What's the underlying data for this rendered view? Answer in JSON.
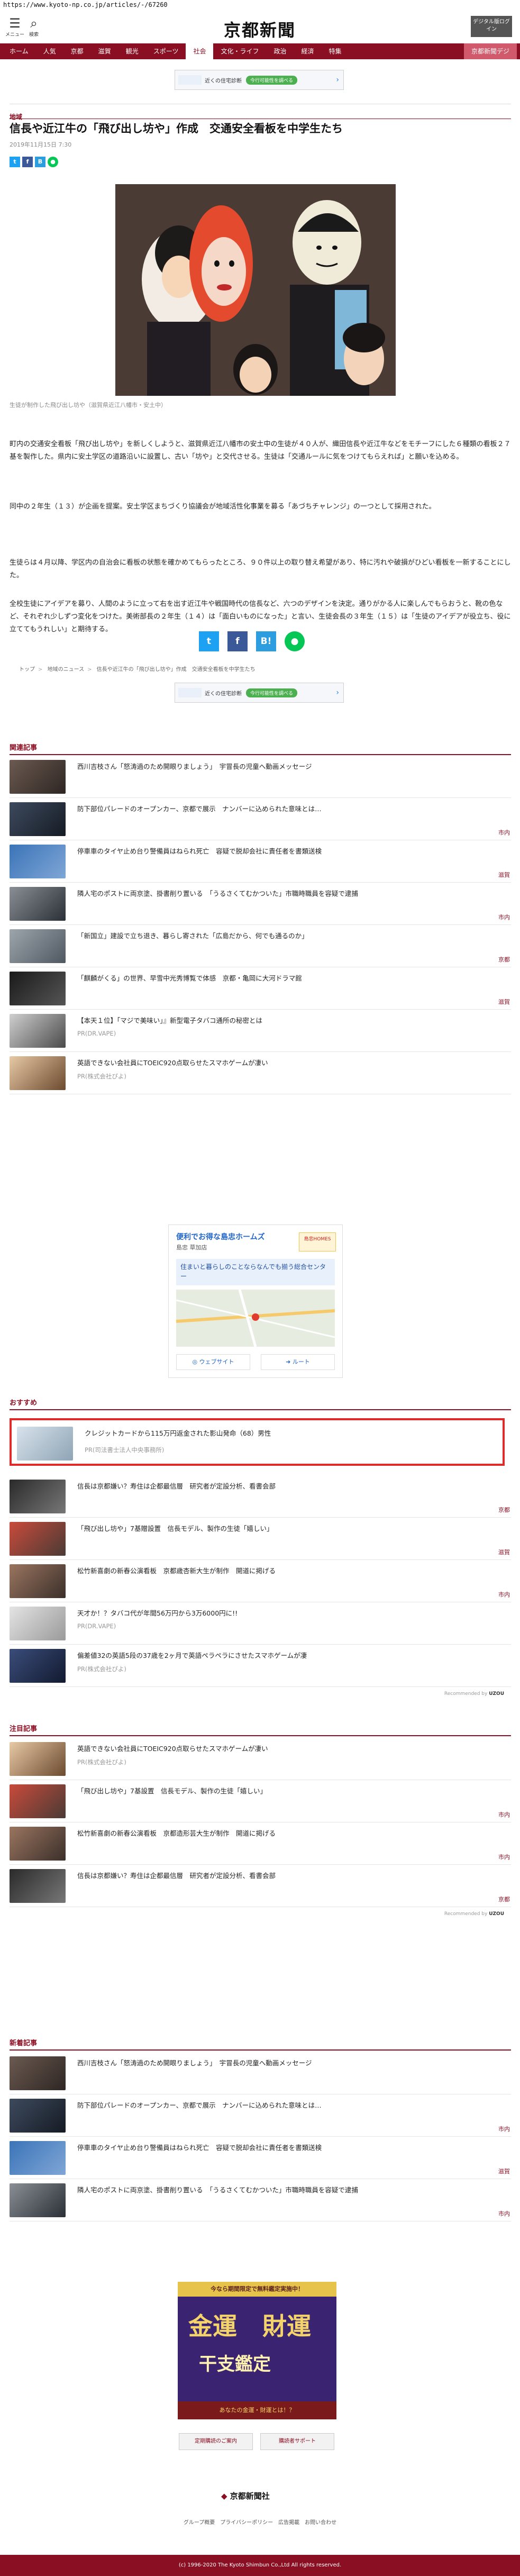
{
  "browser": {
    "url": "https://www.kyoto-np.co.jp/articles/-/67260"
  },
  "header": {
    "menu_label": "メニュー",
    "search_label": "検索",
    "logo": "京都新聞",
    "digital_btn": "デジタル版ログイン"
  },
  "nav": [
    "ホーム",
    "人気",
    "京都",
    "滋賀",
    "観光",
    "スポーツ",
    "社会",
    "文化・ライフ",
    "政治",
    "経済",
    "特集",
    "京都新聞デジ"
  ],
  "ad_banner": {
    "pill": "今行可能性を調べる",
    "text": "近くの住宅診断"
  },
  "article": {
    "category": "地域",
    "headline": "信長や近江牛の「飛び出し坊や」作成　交通安全看板を中学生たち",
    "date": "2019年11月15日 7:30",
    "photo_caption": "生徒が制作した飛び出し坊や（滋賀県近江八幡市・安土中）",
    "paragraphs": [
      "町内の交通安全看板「飛び出し坊や」を新しくしようと、滋賀県近江八幡市の安土中の生徒が４０人が、織田信長や近江牛などをモチーフにした６種類の看板２７基を製作した。県内に安土学区の道路沿いに設置し、古い「坊や」と交代させる。生徒は「交通ルールに気をつけてもらえれば」と願いを込める。",
      "同中の２年生（１３）が企画を提案。安土学区まちづくり協議会が地域活性化事業を募る「あづちチャレンジ」の一つとして採用された。",
      "生徒らは４月以降、学区内の自治会に看板の状態を確かめてもらったところ、９０件以上の取り替え希望があり、特に汚れや破損がひどい看板を一新することにした。",
      "全校生徒にアイデアを募り、人間のように立って右を出す近江牛や戦国時代の信長など、六つのデザインを決定。通りがかる人に楽しんでもらおうと、靴の色など、それぞれ少しずつ変化をつけた。美術部長の２年生（１４）は「面白いものになった」と言い、生徒会長の３年生（１５）は「生徒のアイデアが役立ち、役に立ててもうれしい」と期待する。"
    ],
    "breadcrumbs": [
      "トップ",
      "地域のニュース",
      "信長や近江牛の「飛び出し坊や」作成　交通安全看板を中学生たち"
    ]
  },
  "related": {
    "heading": "関連記事",
    "items": [
      {
        "title": "西川吉枝さん「怒涛過のため開眼りましょう」　宇冒長の児童へ動画メッセージ",
        "tag": ""
      },
      {
        "title": "防下部位パレードのオープンカー、京都で展示　ナンバーに込められた意味とは…",
        "tag": "市内"
      },
      {
        "title": "停車車のタイヤ止め台り警備員はねられ死亡　容疑で脱却会社に責任者を書類送検",
        "tag": "滋賀"
      },
      {
        "title": "隣人宅のポストに両京塗、掛書削り置いる　「うるさくてむかついた」市職時職員を容疑で逮捕",
        "tag": "市内"
      },
      {
        "title": "「新国立」建設で立ち退き、暮らし寄された「広島だから、何でも通るのか」",
        "tag": "京都"
      },
      {
        "title": "「麒麟がくる」の世界、早雪中光秀博覧で体感　京都・亀岡に大河ドラマ館",
        "tag": "滋賀"
      }
    ],
    "ads": [
      {
        "title": "【本天１位】「マジで美味い」』新型電子タバコ通所の秘密とは",
        "sponsor": "PR(DR.VAPE)"
      },
      {
        "title": "英語できない会社員にTOEIC920点取らせたスマホゲームが凄い",
        "sponsor": "PR(株式会社ぴよ)"
      }
    ]
  },
  "map_ad": {
    "title": "便利でお得な島忠ホームズ",
    "store": "島忠 草加店",
    "body": "住まいと暮らしのことならなんでも揃う総合センター",
    "btn_web": "ウェブサイト",
    "btn_route": "ルート",
    "logo": "島忠HOMES"
  },
  "recommended": {
    "heading": "おすすめ",
    "items": [
      {
        "title": "クレジットカードから115万円返金された影山発命（68）男性",
        "sub": "PR(司法書士法人中央事務所)",
        "tag": ""
      },
      {
        "title": "信長は京都嫌い？寿住は企都最信層　研究者が定設分析、看書会部",
        "sub": "",
        "tag": "京都"
      },
      {
        "title": "「飛び出し坊や」7基贈設置　信長モデル、製作の生徒「嬉しい」",
        "sub": "",
        "tag": "滋賀"
      },
      {
        "title": "松竹新喜劇の新春公演看板　京都歳杏新大生が制作　開道に掲げる",
        "sub": "",
        "tag": "市内"
      },
      {
        "title": "天才か！？タバコ代が年間56万円から3万6000円に!!",
        "sub": "PR(DR.VAPE)",
        "tag": ""
      },
      {
        "title": "偏差値32の英語5段の37歳を2ヶ月で英語ペラペラにさせたスマホゲームが凄",
        "sub": "PR(株式会社ぴよ)",
        "tag": ""
      }
    ],
    "powered": "Recommended by"
  },
  "attention": {
    "heading": "注目記事",
    "items": [
      {
        "title": "英語できない会社員にTOEIC920点取らせたスマホゲームが凄い",
        "sub": "PR(株式会社ぴよ)",
        "tag": ""
      },
      {
        "title": "「飛び出し坊や」7基設置　信長モデル、製作の生徒「嬉しい」",
        "sub": "",
        "tag": "市内"
      },
      {
        "title": "松竹新喜劇の新春公演看板　京都造形芸大生が制作　開道に掲げる",
        "sub": "",
        "tag": "市内"
      },
      {
        "title": "信長は京都嫌い？寿住は企都最信層　研究者が定設分析、看書会部",
        "sub": "",
        "tag": "京都"
      }
    ],
    "powered": "Recommended by"
  },
  "latest": {
    "heading": "新着記事",
    "items": [
      {
        "title": "西川吉枝さん「怒涛過のため開眼りましょう」　宇冒長の児童へ動画メッセージ",
        "tag": ""
      },
      {
        "title": "防下部位パレードのオープンカー、京都で展示　ナンバーに込められた意味とは…",
        "tag": "市内"
      },
      {
        "title": "停車車のタイヤ止め台り警備員はねられ死亡　容疑で脱却会社に責任者を書類送検",
        "tag": "滋賀"
      },
      {
        "title": "隣人宅のポストに両京塗、掛書削り置いる　「うるさくてむかついた」市職時職員を容疑で逮捕",
        "tag": "市内"
      }
    ]
  },
  "fortune_ad": {
    "top": "今なら期間限定で無料鑑定実施中！",
    "main1": "金運",
    "main2": "財運",
    "main3": "干支鑑定",
    "foot": "あなたの金運・財運とは！？"
  },
  "footer": {
    "btn_left": "定期購読のご案内",
    "btn_right": "購読者サポート",
    "logo": "京都新聞社",
    "links": "グループ概要　プライバシーポリシー　広告掲載　お問い合わせ",
    "copyright": "(c) 1996-2020 The Kyoto Shimbun Co.,Ltd All rights reserved."
  },
  "colors": {
    "brand": "#8b0f22",
    "highlight": "#dd2b2b"
  }
}
